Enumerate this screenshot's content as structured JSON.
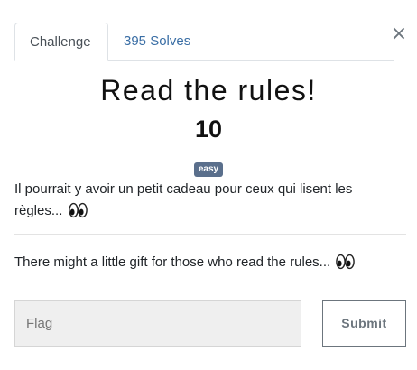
{
  "modal": {
    "close_label": "×",
    "tabs": [
      {
        "label": "Challenge",
        "active": true
      },
      {
        "label": "395 Solves",
        "active": false
      }
    ]
  },
  "challenge": {
    "title": "Read the rules!",
    "points": "10",
    "difficulty": "easy",
    "description_fr": "Il pourrait y avoir un petit cadeau pour ceux qui lisent les règles...",
    "description_en": "There might a little gift for those who read the rules...",
    "emoji_icon": "eyes-icon"
  },
  "form": {
    "flag_placeholder": "Flag",
    "flag_value": "",
    "submit_label": "Submit"
  },
  "colors": {
    "tab_link": "#3a6ea5",
    "badge": "#5a6f8c",
    "input_bg": "#efefef",
    "button_border": "#6c757d"
  }
}
